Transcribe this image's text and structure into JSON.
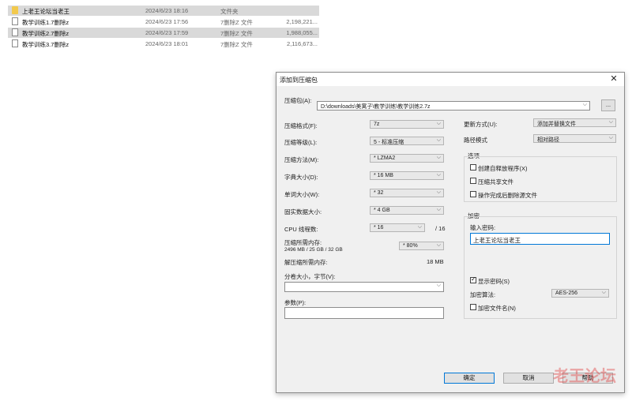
{
  "files": [
    {
      "name": "上老王论坛当老王",
      "date": "2024/6/23 18:16",
      "type": "文件夹",
      "size": "",
      "icon": "folder-icon",
      "selected": true
    },
    {
      "name": "教学训练1.7删除z",
      "date": "2024/6/23 17:56",
      "type": "7删除Z 文件",
      "size": "2,198,221...",
      "icon": "file-icon",
      "selected": false
    },
    {
      "name": "教学训练2.7删除z",
      "date": "2024/6/23 17:59",
      "type": "7删除Z 文件",
      "size": "1,988,055...",
      "icon": "file-icon",
      "selected": true
    },
    {
      "name": "教学训练3.7删除z",
      "date": "2024/6/23 18:01",
      "type": "7删除Z 文件",
      "size": "2,116,673...",
      "icon": "file-icon",
      "selected": false
    }
  ],
  "dialog": {
    "title": "添加到压缩包",
    "close": "✕",
    "archive_label": "压缩包(A):",
    "archive_path": "D:\\downloads\\美寓子\\教学训练\\教学训练2.7z",
    "browse": "...",
    "format_label": "压缩格式(F):",
    "format_value": "7z",
    "level_label": "压缩等级(L):",
    "level_value": "5 - 标准压缩",
    "method_label": "压缩方法(M):",
    "method_value": "* LZMA2",
    "dict_label": "字典大小(D):",
    "dict_value": "* 16 MB",
    "word_label": "单词大小(W):",
    "word_value": "* 32",
    "solid_label": "固实数据大小:",
    "solid_value": "* 4 GB",
    "cpu_label": "CPU 线程数:",
    "cpu_value": "* 16",
    "cpu_max": "/ 16",
    "mem_label": "压缩所需内存:",
    "mem_detail": "2496 MB / 25 GB / 32 GB",
    "mem_value": "* 80%",
    "decomp_label": "解压缩所需内存:",
    "decomp_value": "18 MB",
    "volume_label": "分卷大小，字节(V):",
    "volume_value": "",
    "params_label": "参数(P):",
    "params_value": "",
    "update_label": "更新方式(U):",
    "update_value": "添加并替换文件",
    "path_label": "路径模式",
    "path_value": "相对路径",
    "options_title": "选项",
    "opt_sfx": "创建自释放程序(X)",
    "opt_shared": "压缩共享文件",
    "opt_delete": "操作完成后删除源文件",
    "enc_title": "加密",
    "pwd_label": "输入密码:",
    "pwd_value": "上老王论坛当老王",
    "show_pwd": "显示密码(S)",
    "enc_method_label": "加密算法:",
    "enc_method_value": "AES-256",
    "enc_names": "加密文件名(N)",
    "ok": "确定",
    "cancel": "取消",
    "help": "帮助"
  },
  "watermark": "老王论坛"
}
